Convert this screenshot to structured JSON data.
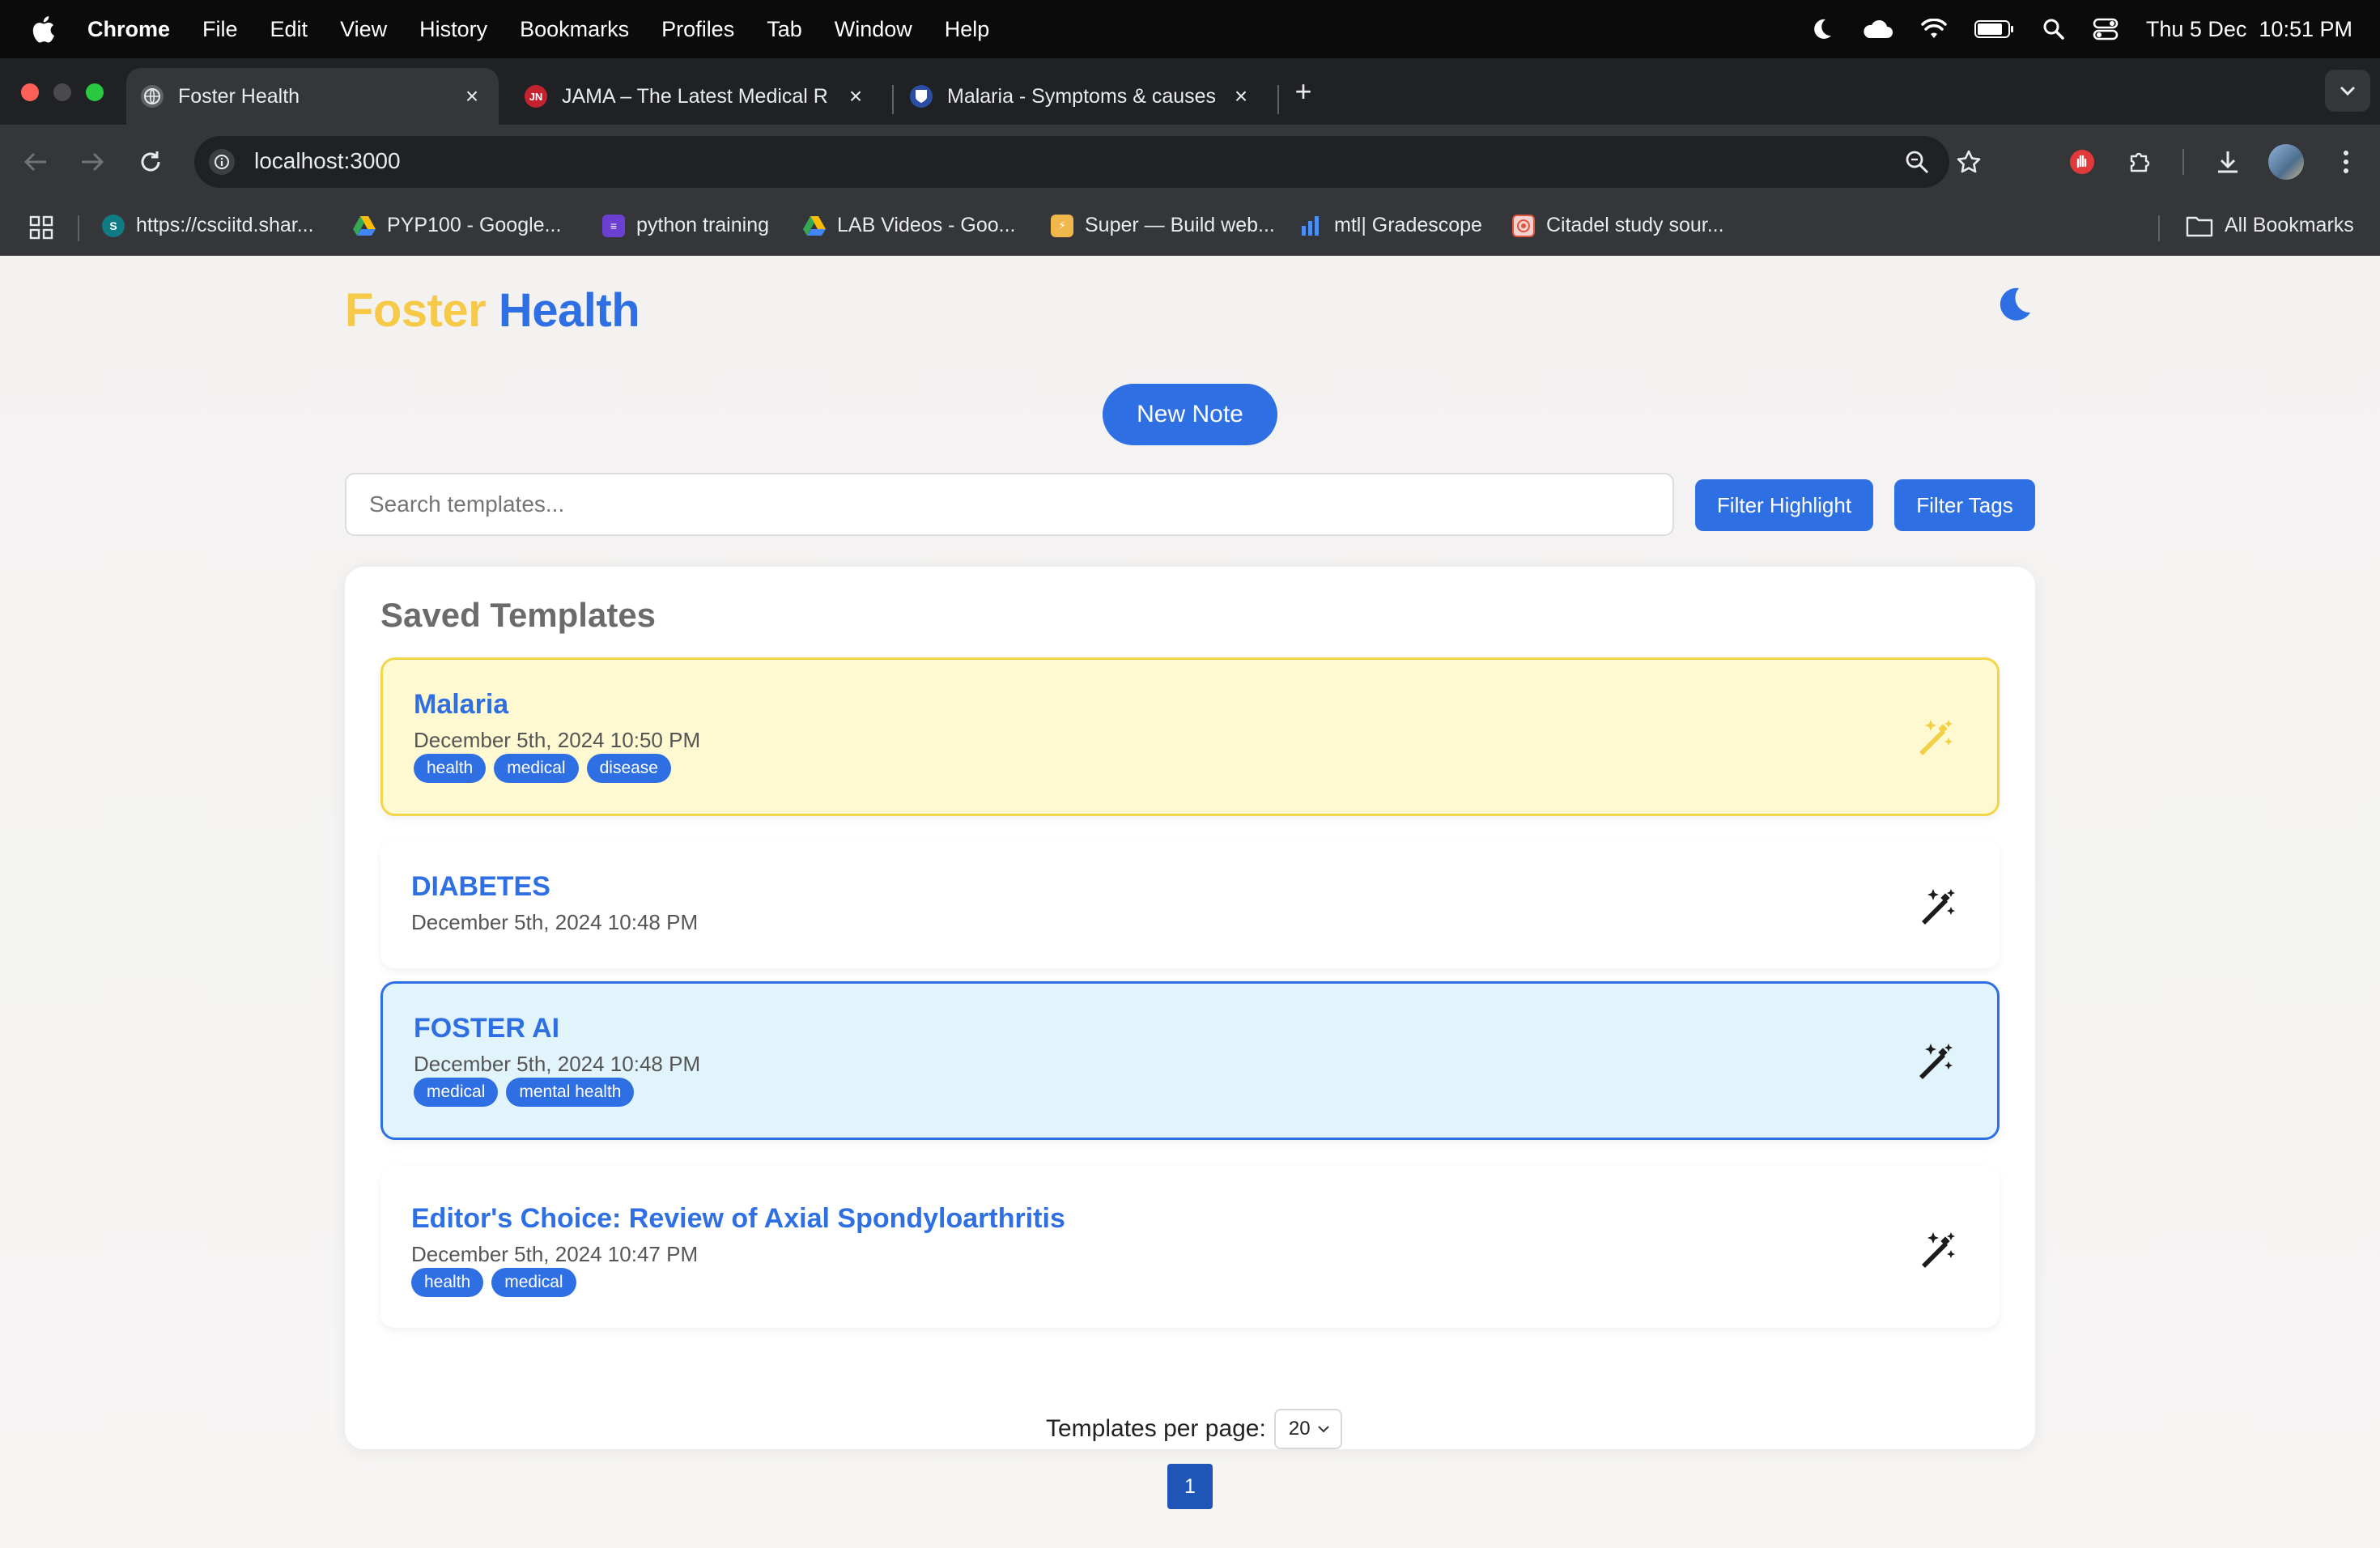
{
  "menubar": {
    "app": "Chrome",
    "items": [
      "File",
      "Edit",
      "View",
      "History",
      "Bookmarks",
      "Profiles",
      "Tab",
      "Window",
      "Help"
    ],
    "clock": "Thu 5 Dec  10:51 PM"
  },
  "tabs": [
    {
      "title": "Foster Health",
      "active": true
    },
    {
      "title": "JAMA – The Latest Medical Re",
      "favicon_text": "JN",
      "active": false
    },
    {
      "title": "Malaria - Symptoms & causes",
      "active": false
    }
  ],
  "omnibox": {
    "url": "localhost:3000"
  },
  "bookmarks": [
    {
      "label": "https://csciitd.shar...",
      "icon": "sharepoint-icon"
    },
    {
      "label": "PYP100 - Google...",
      "icon": "google-drive-icon"
    },
    {
      "label": "python training",
      "icon": "forms-icon"
    },
    {
      "label": "LAB Videos - Goo...",
      "icon": "google-drive-icon"
    },
    {
      "label": "Super — Build web...",
      "icon": "super-icon"
    },
    {
      "label": "mtl| Gradescope",
      "icon": "gradescope-icon"
    },
    {
      "label": "Citadel study sour...",
      "icon": "citadel-icon"
    }
  ],
  "all_bookmarks": "All Bookmarks",
  "app": {
    "brand_part1": "Foster",
    "brand_part2": "Health",
    "new_note": "New Note",
    "search_placeholder": "Search templates...",
    "filter_highlight": "Filter Highlight",
    "filter_tags": "Filter Tags",
    "panel_title": "Saved Templates",
    "templates": [
      {
        "title": "Malaria",
        "date": "December 5th, 2024 10:50 PM",
        "tags": [
          "health",
          "medical",
          "disease"
        ],
        "highlight": "yellow"
      },
      {
        "title": "DIABETES",
        "date": "December 5th, 2024 10:48 PM",
        "tags": [],
        "highlight": "none"
      },
      {
        "title": "FOSTER AI",
        "date": "December 5th, 2024 10:48 PM",
        "tags": [
          "medical",
          "mental health"
        ],
        "highlight": "blue"
      },
      {
        "title": "Editor's Choice: Review of Axial Spondyloarthritis",
        "date": "December 5th, 2024 10:47 PM",
        "tags": [
          "health",
          "medical"
        ],
        "highlight": "none"
      }
    ],
    "per_page_label": "Templates per page:",
    "per_page_value": "20",
    "current_page": "1"
  },
  "colors": {
    "brand_yellow": "#f7c948",
    "brand_blue": "#2f6fe4",
    "highlight_yellow_bg": "#fef9d0",
    "highlight_blue_bg": "#e2f4fb"
  }
}
